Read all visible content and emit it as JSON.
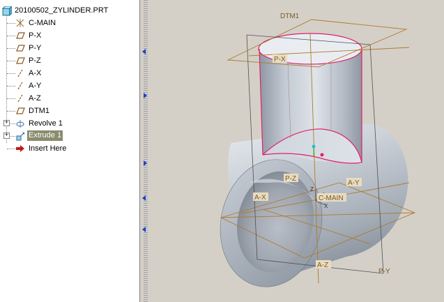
{
  "tree": {
    "root_label": "20100502_ZYLINDER.PRT",
    "items": [
      {
        "label": "C-MAIN",
        "icon": "csys-icon",
        "expander": ""
      },
      {
        "label": "P-X",
        "icon": "datum-plane-icon",
        "expander": ""
      },
      {
        "label": "P-Y",
        "icon": "datum-plane-icon",
        "expander": ""
      },
      {
        "label": "P-Z",
        "icon": "datum-plane-icon",
        "expander": ""
      },
      {
        "label": "A-X",
        "icon": "datum-axis-icon",
        "expander": ""
      },
      {
        "label": "A-Y",
        "icon": "datum-axis-icon",
        "expander": ""
      },
      {
        "label": "A-Z",
        "icon": "datum-axis-icon",
        "expander": ""
      },
      {
        "label": "DTM1",
        "icon": "datum-plane-icon",
        "expander": ""
      },
      {
        "label": "Revolve 1",
        "icon": "revolve-icon",
        "expander": "+"
      },
      {
        "label": "Extrude 1",
        "icon": "extrude-icon",
        "expander": "+"
      },
      {
        "label": "Insert Here",
        "icon": "insert-arrow-icon",
        "expander": ""
      }
    ],
    "selected_index": 9,
    "selected_color": "#8b8b6e"
  },
  "viewport": {
    "labels": {
      "dtm1": "DTM1",
      "px": "P-X",
      "pz": "P-Z",
      "ay": "A-Y",
      "ax": "A-X",
      "cmain": "C-MAIN",
      "az": "A-Z",
      "py": "P-Y",
      "csys_z": "Z",
      "csys_x": "X"
    },
    "colors": {
      "datum": "#b07a30",
      "edge_highlight": "#e0206a",
      "frame": "#505050"
    }
  }
}
